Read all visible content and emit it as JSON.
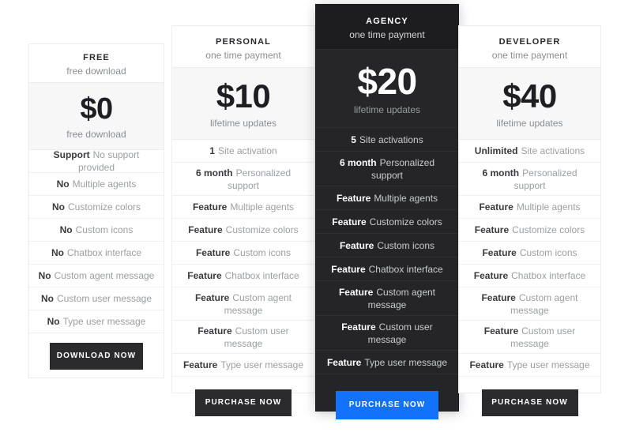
{
  "accent": {
    "featured_button": "#1272fb",
    "dark_button": "#2b2b2e",
    "dark_card": "#252528",
    "price_band": "#f7f7f7"
  },
  "plans": [
    {
      "id": "free",
      "name": "FREE",
      "subtitle": "free download",
      "price": "$0",
      "price_note": "free download",
      "features": [
        {
          "strong": "Support",
          "text": "No support provided"
        },
        {
          "strong": "No",
          "text": "Multiple agents"
        },
        {
          "strong": "No",
          "text": "Customize colors"
        },
        {
          "strong": "No",
          "text": "Custom icons"
        },
        {
          "strong": "No",
          "text": "Chatbox interface"
        },
        {
          "strong": "No",
          "text": "Custom agent message"
        },
        {
          "strong": "No",
          "text": "Custom user message"
        },
        {
          "strong": "No",
          "text": "Type user message"
        }
      ],
      "cta": "DOWNLOAD NOW"
    },
    {
      "id": "personal",
      "name": "PERSONAL",
      "subtitle": "one time payment",
      "price": "$10",
      "price_note": "lifetime updates",
      "features": [
        {
          "strong": "1",
          "text": "Site activation"
        },
        {
          "strong": "6 month",
          "text": "Personalized support"
        },
        {
          "strong": "Feature",
          "text": "Multiple agents"
        },
        {
          "strong": "Feature",
          "text": "Customize colors"
        },
        {
          "strong": "Feature",
          "text": "Custom icons"
        },
        {
          "strong": "Feature",
          "text": "Chatbox interface"
        },
        {
          "strong": "Feature",
          "text": "Custom agent message"
        },
        {
          "strong": "Feature",
          "text": "Custom user message"
        },
        {
          "strong": "Feature",
          "text": "Type user message"
        }
      ],
      "cta": "PURCHASE NOW"
    },
    {
      "id": "agency",
      "name": "AGENCY",
      "subtitle": "one time payment",
      "price": "$20",
      "price_note": "lifetime updates",
      "features": [
        {
          "strong": "5",
          "text": "Site activations"
        },
        {
          "strong": "6 month",
          "text": "Personalized support"
        },
        {
          "strong": "Feature",
          "text": "Multiple agents"
        },
        {
          "strong": "Feature",
          "text": "Customize colors"
        },
        {
          "strong": "Feature",
          "text": "Custom icons"
        },
        {
          "strong": "Feature",
          "text": "Chatbox interface"
        },
        {
          "strong": "Feature",
          "text": "Custom agent message"
        },
        {
          "strong": "Feature",
          "text": "Custom user message"
        },
        {
          "strong": "Feature",
          "text": "Type user message"
        }
      ],
      "cta": "PURCHASE NOW"
    },
    {
      "id": "developer",
      "name": "DEVELOPER",
      "subtitle": "one time payment",
      "price": "$40",
      "price_note": "lifetime updates",
      "features": [
        {
          "strong": "Unlimited",
          "text": "Site activations"
        },
        {
          "strong": "6 month",
          "text": "Personalized support"
        },
        {
          "strong": "Feature",
          "text": "Multiple agents"
        },
        {
          "strong": "Feature",
          "text": "Customize colors"
        },
        {
          "strong": "Feature",
          "text": "Custom icons"
        },
        {
          "strong": "Feature",
          "text": "Chatbox interface"
        },
        {
          "strong": "Feature",
          "text": "Custom agent message"
        },
        {
          "strong": "Feature",
          "text": "Custom user message"
        },
        {
          "strong": "Feature",
          "text": "Type user message"
        }
      ],
      "cta": "PURCHASE NOW"
    }
  ]
}
